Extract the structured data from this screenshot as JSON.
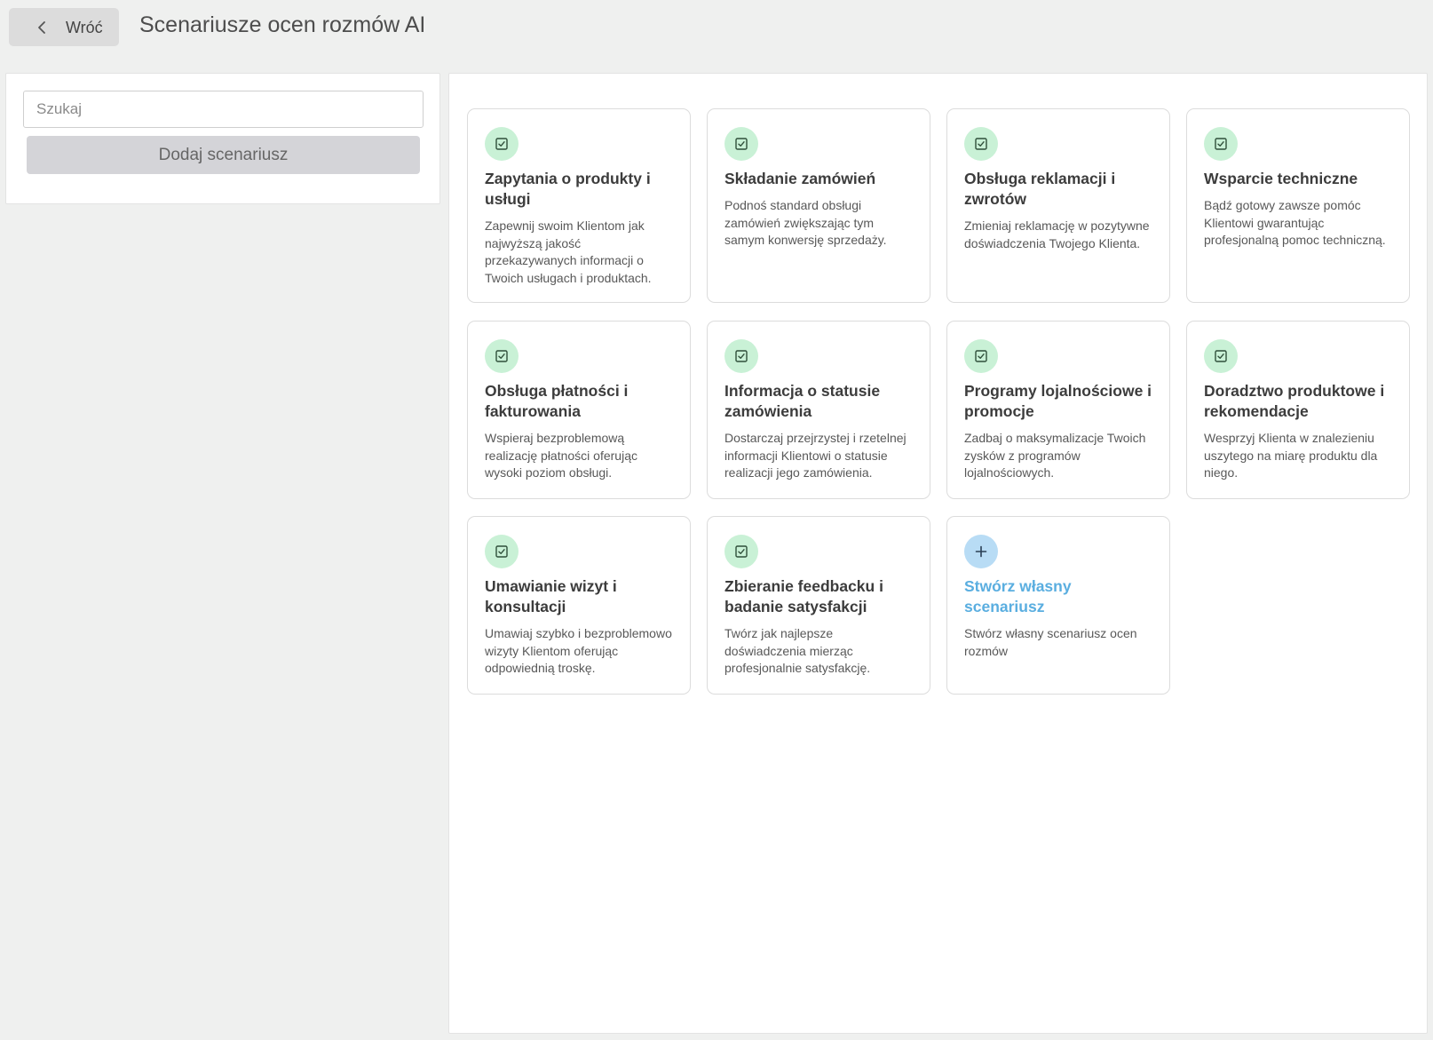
{
  "header": {
    "back_label": "Wróć",
    "title": "Scenariusze ocen rozmów AI"
  },
  "sidebar": {
    "search_placeholder": "Szukaj",
    "add_label": "Dodaj scenariusz"
  },
  "cards": [
    {
      "title": "Zapytania o produkty i usługi",
      "desc": "Zapewnij swoim Klientom jak najwyższą jakość przekazywanych informacji o Twoich usługach i produktach.",
      "icon": "checkbox-icon"
    },
    {
      "title": "Składanie zamówień",
      "desc": "Podnoś standard obsługi zamówień zwiększając tym samym konwersję sprzedaży.",
      "icon": "checkbox-icon"
    },
    {
      "title": "Obsługa reklamacji i zwrotów",
      "desc": "Zmieniaj reklamację w pozytywne doświadczenia Twojego Klienta.",
      "icon": "checkbox-icon"
    },
    {
      "title": "Wsparcie techniczne",
      "desc": "Bądź gotowy zawsze pomóc Klientowi gwarantując profesjonalną pomoc techniczną.",
      "icon": "checkbox-icon"
    },
    {
      "title": "Obsługa płatności i fakturowania",
      "desc": "Wspieraj bezproblemową realizację płatności oferując wysoki poziom obsługi.",
      "icon": "checkbox-icon"
    },
    {
      "title": "Informacja o statusie zamówienia",
      "desc": "Dostarczaj przejrzystej i rzetelnej informacji Klientowi o statusie realizacji jego zamówienia.",
      "icon": "checkbox-icon"
    },
    {
      "title": "Programy lojalnościowe i promocje",
      "desc": "Zadbaj o maksymalizacje Twoich zysków z programów lojalnościowych.",
      "icon": "checkbox-icon"
    },
    {
      "title": "Doradztwo produktowe i rekomendacje",
      "desc": "Wesprzyj Klienta w znalezieniu uszytego na miarę produktu dla niego.",
      "icon": "checkbox-icon"
    },
    {
      "title": "Umawianie wizyt i konsultacji",
      "desc": "Umawiaj szybko i bezproblemowo wizyty Klientom oferując odpowiednią troskę.",
      "icon": "checkbox-icon"
    },
    {
      "title": "Zbieranie feedbacku i badanie satysfakcji",
      "desc": "Twórz jak najlepsze doświadczenia mierząc profesjonalnie satysfakcję.",
      "icon": "checkbox-icon"
    },
    {
      "title": "Stwórz własny scenariusz",
      "desc": "Stwórz własny scenariusz ocen rozmów",
      "icon": "plus-icon"
    }
  ],
  "colors": {
    "icon_bg_green": "#c9f1d6",
    "icon_bg_blue": "#b8dcf5",
    "link_blue": "#5aaee0"
  }
}
